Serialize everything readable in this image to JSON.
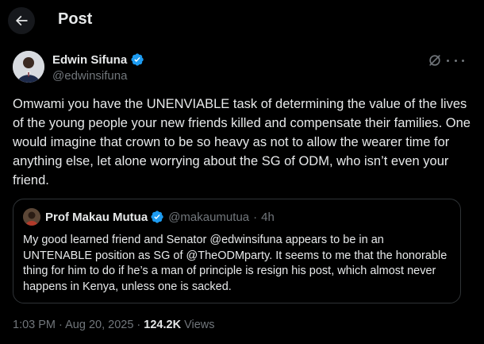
{
  "header": {
    "title": "Post"
  },
  "author": {
    "name": "Edwin Sifuna",
    "handle": "@edwinsifuna"
  },
  "tweet": {
    "text": "Omwami you have the UNENVIABLE task of determining the value of the lives of the young people your new friends killed and compensate their families. One would imagine that crown to be so heavy as not to allow the wearer time for anything else, let alone worrying about the SG of ODM, who isn’t even your friend."
  },
  "quote": {
    "name": "Prof Makau Mutua",
    "handle": "@makaumutua",
    "separator": "·",
    "time": "4h",
    "text": "My good learned friend and Senator @edwinsifuna appears to be in an UNTENABLE position as SG of @TheODMparty.  It seems to me that the honorable thing for him to do if he’s a man of principle is resign his post, which almost never happens in Kenya, unless one is sacked."
  },
  "meta": {
    "time": "1:03 PM",
    "date": "Aug 20, 2025",
    "separator": "·",
    "views_count": "124.2K",
    "views_label": "Views"
  },
  "colors": {
    "verified": "#1d9bf0",
    "secondary_text": "#71767b",
    "border": "#2f3336"
  },
  "icons": [
    "back-arrow-icon",
    "verified-icon",
    "grok-icon",
    "more-icon"
  ]
}
